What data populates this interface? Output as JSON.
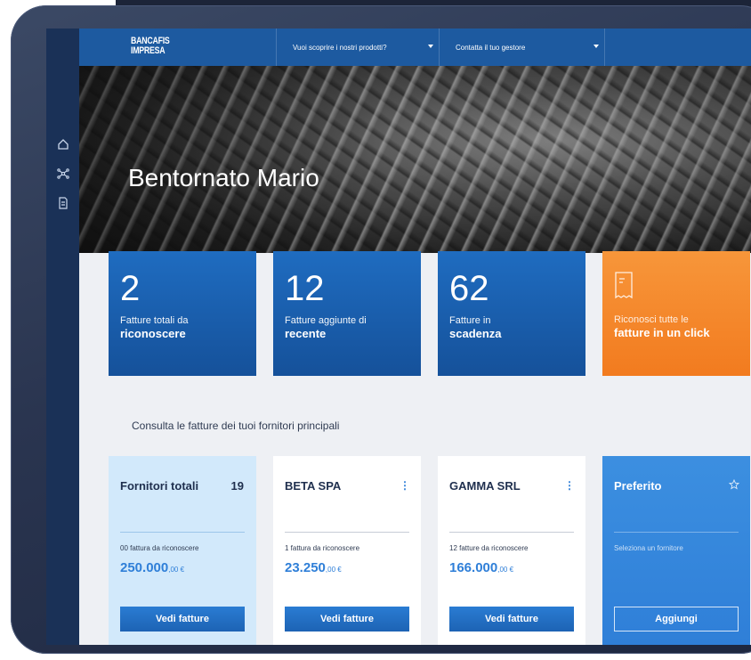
{
  "header": {
    "logo_line1": "BANCAFIS",
    "logo_line2": "IMPRESA",
    "nav": [
      {
        "label": "Vuoi scoprire i nostri prodotti?"
      },
      {
        "label": "Contatta il tuo gestore"
      }
    ]
  },
  "sidebar": {
    "items": [
      {
        "icon": "home-icon"
      },
      {
        "icon": "network-icon"
      },
      {
        "icon": "document-icon"
      }
    ]
  },
  "hero": {
    "title": "Bentornato Mario"
  },
  "tiles": [
    {
      "number": "2",
      "line1": "Fatture totali da",
      "line2": "riconoscere"
    },
    {
      "number": "12",
      "line1": "Fatture aggiunte di",
      "line2": "recente"
    },
    {
      "number": "62",
      "line1": "Fatture in",
      "line2": "scadenza"
    },
    {
      "icon": "invoice-icon",
      "line1": "Riconosci tutte le",
      "line2": "fatture in un click"
    }
  ],
  "section_title": "Consulta le fatture dei tuoi fornitori principali",
  "cards": [
    {
      "title": "Fornitori totali",
      "count": "19",
      "desc": "00 fattura da riconoscere",
      "amount": "250.000",
      "amount_dec": ",00 €",
      "button": "Vedi fatture"
    },
    {
      "title": "BETA SPA",
      "menu": "⋮",
      "desc": "1 fattura da riconoscere",
      "amount": "23.250",
      "amount_dec": ",00 €",
      "button": "Vedi fatture"
    },
    {
      "title": "GAMMA SRL",
      "menu": "⋮",
      "desc": "12 fatture da riconoscere",
      "amount": "166.000",
      "amount_dec": ",00 €",
      "button": "Vedi fatture"
    },
    {
      "title": "Preferito",
      "icon": "star-icon",
      "desc": "Seleziona un fornitore",
      "button": "Aggiungi"
    }
  ],
  "colors": {
    "primary": "#1d5aa0",
    "tile_blue": "#1f6cc0",
    "tile_orange": "#f7963a",
    "sidebar": "#1a3157",
    "accent_amount": "#2f7fd8",
    "light_card": "#d2e9fb"
  }
}
